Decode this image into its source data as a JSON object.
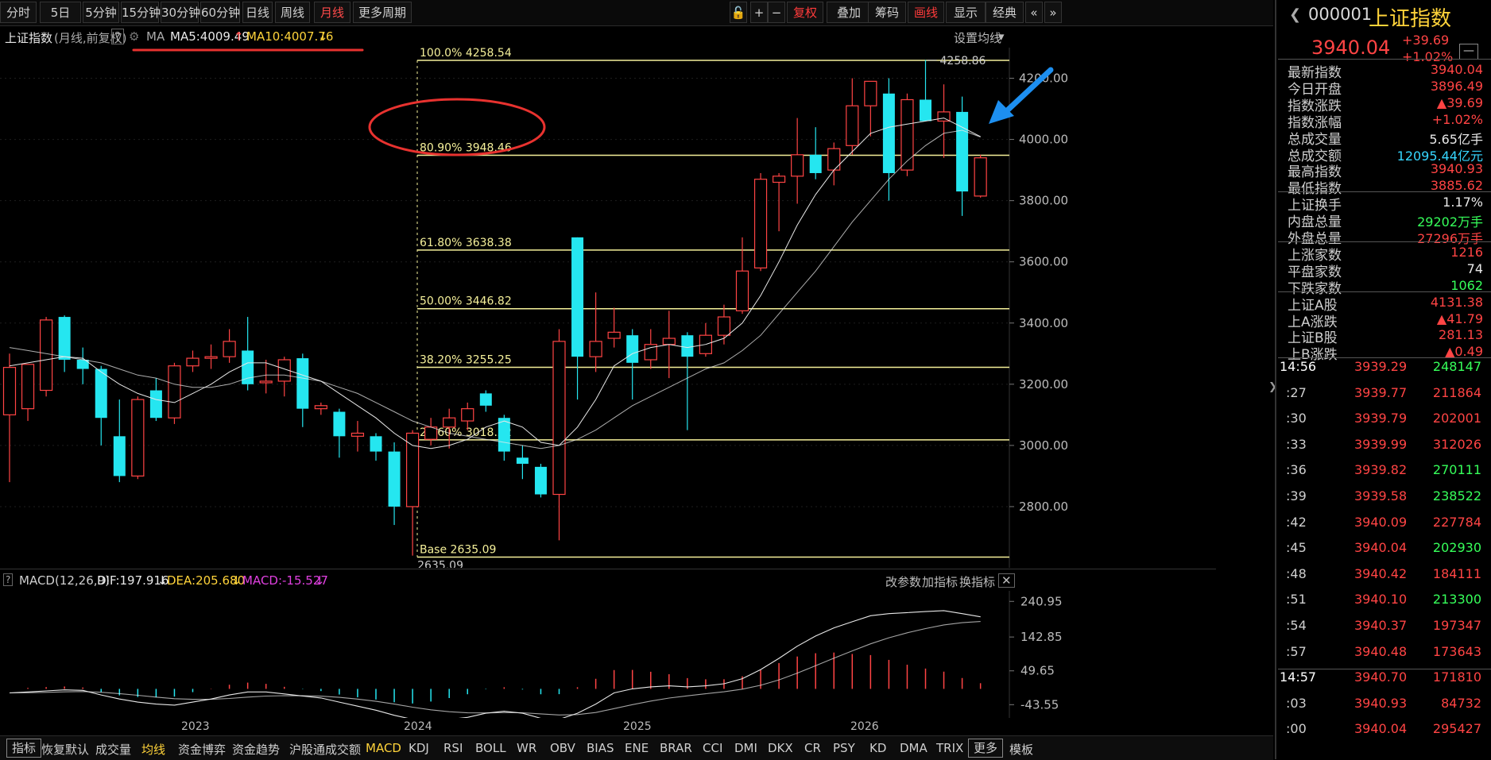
{
  "toolbar": {
    "periods": [
      "分时",
      "5日",
      "5分钟",
      "15分钟",
      "30分钟",
      "60分钟",
      "日线",
      "周线",
      "月线",
      "更多周期"
    ],
    "active_period": "月线",
    "tools": [
      "复权",
      "叠加",
      "筹码",
      "画线",
      "显示",
      "经典"
    ],
    "active_tool": "画线"
  },
  "indicator_line": {
    "title": "上证指数",
    "subtitle": "(月线,前复权)",
    "help": "?",
    "ma_label": "MA",
    "ma5": "MA5:4009.49",
    "ma10": "MA10:4007.76",
    "setting": "设置均线"
  },
  "chart_data": {
    "type": "candlestick",
    "title": "上证指数",
    "price_axis": {
      "ticks": [
        "4200.00",
        "4000.00",
        "3800.00",
        "3600.00",
        "3400.00",
        "3200.00",
        "3000.00",
        "2800.00"
      ],
      "ylim": [
        2600,
        4300
      ]
    },
    "x_labels": [
      "2023",
      "2024",
      "2025",
      "2026"
    ],
    "fibonacci": [
      {
        "label": "100.0% 4258.54",
        "value": 4258.54
      },
      {
        "label": "80.90% 3948.46",
        "value": 3948.46
      },
      {
        "label": "61.80% 3638.38",
        "value": 3638.38
      },
      {
        "label": "50.00% 3446.82",
        "value": 3446.82
      },
      {
        "label": "38.20% 3255.25",
        "value": 3255.25
      },
      {
        "label": "23.60% 3018.22",
        "value": 3018.22
      },
      {
        "label": "Base  2635.09",
        "value": 2635.09
      }
    ],
    "high_mark": "4258.86",
    "low_mark": "2635.09",
    "candles": [
      {
        "o": 3100,
        "h": 3300,
        "l": 2880,
        "c": 3255
      },
      {
        "o": 3120,
        "h": 3230,
        "l": 3080,
        "c": 3265
      },
      {
        "o": 3180,
        "h": 3420,
        "l": 3160,
        "c": 3410
      },
      {
        "o": 3420,
        "h": 3425,
        "l": 3240,
        "c": 3280
      },
      {
        "o": 3280,
        "h": 3320,
        "l": 3200,
        "c": 3250
      },
      {
        "o": 3250,
        "h": 3260,
        "l": 3000,
        "c": 3090
      },
      {
        "o": 3030,
        "h": 3150,
        "l": 2880,
        "c": 2900
      },
      {
        "o": 2900,
        "h": 3160,
        "l": 2890,
        "c": 3150
      },
      {
        "o": 3180,
        "h": 3220,
        "l": 3080,
        "c": 3090
      },
      {
        "o": 3090,
        "h": 3270,
        "l": 3070,
        "c": 3260
      },
      {
        "o": 3260,
        "h": 3310,
        "l": 3240,
        "c": 3285
      },
      {
        "o": 3285,
        "h": 3330,
        "l": 3250,
        "c": 3290
      },
      {
        "o": 3290,
        "h": 3380,
        "l": 3270,
        "c": 3340
      },
      {
        "o": 3310,
        "h": 3420,
        "l": 3180,
        "c": 3200
      },
      {
        "o": 3205,
        "h": 3280,
        "l": 3170,
        "c": 3210
      },
      {
        "o": 3210,
        "h": 3290,
        "l": 3160,
        "c": 3280
      },
      {
        "o": 3285,
        "h": 3300,
        "l": 3060,
        "c": 3120
      },
      {
        "o": 3120,
        "h": 3140,
        "l": 3100,
        "c": 3130
      },
      {
        "o": 3110,
        "h": 3120,
        "l": 2960,
        "c": 3030
      },
      {
        "o": 3030,
        "h": 3080,
        "l": 2980,
        "c": 3040
      },
      {
        "o": 3030,
        "h": 3040,
        "l": 2950,
        "c": 2980
      },
      {
        "o": 2980,
        "h": 3010,
        "l": 2740,
        "c": 2800
      },
      {
        "o": 2800,
        "h": 3050,
        "l": 2640,
        "c": 3040
      },
      {
        "o": 3020,
        "h": 3090,
        "l": 3000,
        "c": 3060
      },
      {
        "o": 3060,
        "h": 3120,
        "l": 2990,
        "c": 3090
      },
      {
        "o": 3080,
        "h": 3140,
        "l": 3050,
        "c": 3120
      },
      {
        "o": 3170,
        "h": 3180,
        "l": 3110,
        "c": 3130
      },
      {
        "o": 3090,
        "h": 3100,
        "l": 2950,
        "c": 2980
      },
      {
        "o": 2960,
        "h": 3000,
        "l": 2890,
        "c": 2940
      },
      {
        "o": 2930,
        "h": 2940,
        "l": 2830,
        "c": 2840
      },
      {
        "o": 2840,
        "h": 3380,
        "l": 2690,
        "c": 3340
      },
      {
        "o": 3680,
        "h": 3680,
        "l": 3150,
        "c": 3290
      },
      {
        "o": 3290,
        "h": 3500,
        "l": 3240,
        "c": 3340
      },
      {
        "o": 3350,
        "h": 3450,
        "l": 3320,
        "c": 3370
      },
      {
        "o": 3360,
        "h": 3380,
        "l": 3150,
        "c": 3270
      },
      {
        "o": 3280,
        "h": 3380,
        "l": 3250,
        "c": 3330
      },
      {
        "o": 3330,
        "h": 3440,
        "l": 3220,
        "c": 3350
      },
      {
        "o": 3360,
        "h": 3370,
        "l": 3050,
        "c": 3290
      },
      {
        "o": 3300,
        "h": 3400,
        "l": 3290,
        "c": 3360
      },
      {
        "o": 3360,
        "h": 3460,
        "l": 3330,
        "c": 3420
      },
      {
        "o": 3440,
        "h": 3680,
        "l": 3430,
        "c": 3570
      },
      {
        "o": 3580,
        "h": 3890,
        "l": 3570,
        "c": 3870
      },
      {
        "o": 3860,
        "h": 3890,
        "l": 3700,
        "c": 3880
      },
      {
        "o": 3880,
        "h": 4070,
        "l": 3790,
        "c": 3950
      },
      {
        "o": 3950,
        "h": 4040,
        "l": 3870,
        "c": 3890
      },
      {
        "o": 3900,
        "h": 3990,
        "l": 3850,
        "c": 3970
      },
      {
        "o": 3980,
        "h": 4200,
        "l": 3950,
        "c": 4110
      },
      {
        "o": 4110,
        "h": 4190,
        "l": 4010,
        "c": 4190
      },
      {
        "o": 4150,
        "h": 4200,
        "l": 3800,
        "c": 3890
      },
      {
        "o": 3900,
        "h": 4150,
        "l": 3880,
        "c": 4130
      },
      {
        "o": 4130,
        "h": 4260,
        "l": 4060,
        "c": 4060
      },
      {
        "o": 4060,
        "h": 4180,
        "l": 3940,
        "c": 4090
      },
      {
        "o": 4090,
        "h": 4140,
        "l": 3750,
        "c": 3830
      },
      {
        "o": 3815,
        "h": 3950,
        "l": 3810,
        "c": 3940
      }
    ],
    "ma5": [
      3260,
      3270,
      3280,
      3290,
      3285,
      3240,
      3200,
      3170,
      3150,
      3140,
      3170,
      3200,
      3240,
      3270,
      3270,
      3250,
      3230,
      3210,
      3170,
      3130,
      3090,
      3040,
      3000,
      2990,
      3000,
      3020,
      3060,
      3080,
      3060,
      3010,
      3000,
      3060,
      3150,
      3260,
      3300,
      3320,
      3330,
      3320,
      3330,
      3350,
      3400,
      3490,
      3600,
      3720,
      3820,
      3900,
      3960,
      4020,
      4040,
      4050,
      4060,
      4070,
      4040,
      4009
    ],
    "ma10": [
      3320,
      3310,
      3300,
      3290,
      3280,
      3270,
      3250,
      3230,
      3220,
      3200,
      3190,
      3190,
      3200,
      3220,
      3230,
      3230,
      3220,
      3210,
      3190,
      3170,
      3140,
      3110,
      3080,
      3060,
      3040,
      3030,
      3020,
      3010,
      3000,
      2990,
      3000,
      3020,
      3050,
      3090,
      3130,
      3160,
      3190,
      3220,
      3250,
      3270,
      3310,
      3360,
      3430,
      3500,
      3570,
      3650,
      3730,
      3800,
      3870,
      3930,
      3980,
      4020,
      4030,
      4008
    ],
    "macd": {
      "label": "MACD(12,26,9)",
      "dif": "DIF:197.916",
      "dea": "DEA:205.680",
      "macd": "MACD:-15.527",
      "axis_ticks": [
        "240.95",
        "142.85",
        "49.65",
        "-43.55"
      ],
      "ylim": [
        -80,
        270
      ]
    }
  },
  "macd_actions": [
    "改参数",
    "加指标",
    "换指标"
  ],
  "bottom_tabs": [
    "指标",
    "恢复默认",
    "成交量",
    "均线",
    "资金博弈",
    "资金趋势",
    "沪股通成交额",
    "MACD",
    "KDJ",
    "RSI",
    "BOLL",
    "WR",
    "OBV",
    "BIAS",
    "ENE",
    "BRAR",
    "CCI",
    "DMI",
    "DKX",
    "CR",
    "PSY",
    "KD",
    "DMA",
    "TRIX",
    "更多",
    "模板"
  ],
  "side": {
    "code": "000001",
    "name": "上证指数",
    "price": "3940.04",
    "change": "+39.69",
    "change_pct": "+1.02%",
    "stats": [
      {
        "label": "最新指数",
        "value": "3940.04",
        "color": "#ff4444"
      },
      {
        "label": "今日开盘",
        "value": "3896.49",
        "color": "#ff4444"
      },
      {
        "label": "指数涨跌",
        "value": "▲39.69",
        "color": "#ff4444"
      },
      {
        "label": "指数涨幅",
        "value": "+1.02%",
        "color": "#ff4444"
      },
      {
        "label": "总成交量",
        "value": "5.65亿手",
        "color": "#e8e8e8"
      },
      {
        "label": "总成交额",
        "value": "12095.44亿元",
        "color": "#36d6ff"
      },
      {
        "label": "最高指数",
        "value": "3940.93",
        "color": "#ff4444"
      },
      {
        "label": "最低指数",
        "value": "3885.62",
        "color": "#ff4444"
      },
      {
        "label": "上证换手",
        "value": "1.17%",
        "color": "#e8e8e8"
      },
      {
        "label": "内盘总量",
        "value": "29202万手",
        "color": "#36ff5a"
      },
      {
        "label": "外盘总量",
        "value": "27296万手",
        "color": "#ff4444"
      },
      {
        "label": "上涨家数",
        "value": "1216",
        "color": "#ff4444"
      },
      {
        "label": "平盘家数",
        "value": "74",
        "color": "#e8e8e8"
      },
      {
        "label": "下跌家数",
        "value": "1062",
        "color": "#36ff5a"
      },
      {
        "label": "上证A股",
        "value": "4131.38",
        "color": "#ff4444"
      },
      {
        "label": "上A涨跌",
        "value": "▲41.79",
        "color": "#ff4444"
      },
      {
        "label": "上证B股",
        "value": "281.13",
        "color": "#ff4444"
      },
      {
        "label": "上B涨跌",
        "value": "▲0.49",
        "color": "#ff4444"
      }
    ],
    "ticks": [
      {
        "t": "14:56",
        "p": "3939.29",
        "v": "248147",
        "c": "#36ff5a"
      },
      {
        "t": ":27",
        "p": "3939.77",
        "v": "211864",
        "c": "#ff4444"
      },
      {
        "t": ":30",
        "p": "3939.79",
        "v": "202001",
        "c": "#ff4444"
      },
      {
        "t": ":33",
        "p": "3939.99",
        "v": "312026",
        "c": "#ff4444"
      },
      {
        "t": ":36",
        "p": "3939.82",
        "v": "270111",
        "c": "#36ff5a"
      },
      {
        "t": ":39",
        "p": "3939.58",
        "v": "238522",
        "c": "#36ff5a"
      },
      {
        "t": ":42",
        "p": "3940.09",
        "v": "227784",
        "c": "#ff4444"
      },
      {
        "t": ":45",
        "p": "3940.04",
        "v": "202930",
        "c": "#36ff5a"
      },
      {
        "t": ":48",
        "p": "3940.42",
        "v": "184111",
        "c": "#ff4444"
      },
      {
        "t": ":51",
        "p": "3940.10",
        "v": "213300",
        "c": "#36ff5a"
      },
      {
        "t": ":54",
        "p": "3940.37",
        "v": "197347",
        "c": "#ff4444"
      },
      {
        "t": ":57",
        "p": "3940.48",
        "v": "173643",
        "c": "#ff4444"
      },
      {
        "t": "14:57",
        "p": "3940.70",
        "v": "171810",
        "c": "#ff4444"
      },
      {
        "t": ":03",
        "p": "3940.93",
        "v": "84732",
        "c": "#ff4444"
      },
      {
        "t": ":00",
        "p": "3940.04",
        "v": "295427",
        "c": "#ff4444"
      }
    ]
  },
  "colors": {
    "up": "#ff4444",
    "down": "#25e6f0",
    "fib": "#f5f09a",
    "annotation_red": "#e8322f",
    "arrow_blue": "#1d8ff0",
    "ma5": "#e8e8e8",
    "ma10": "#e8e8e8"
  }
}
